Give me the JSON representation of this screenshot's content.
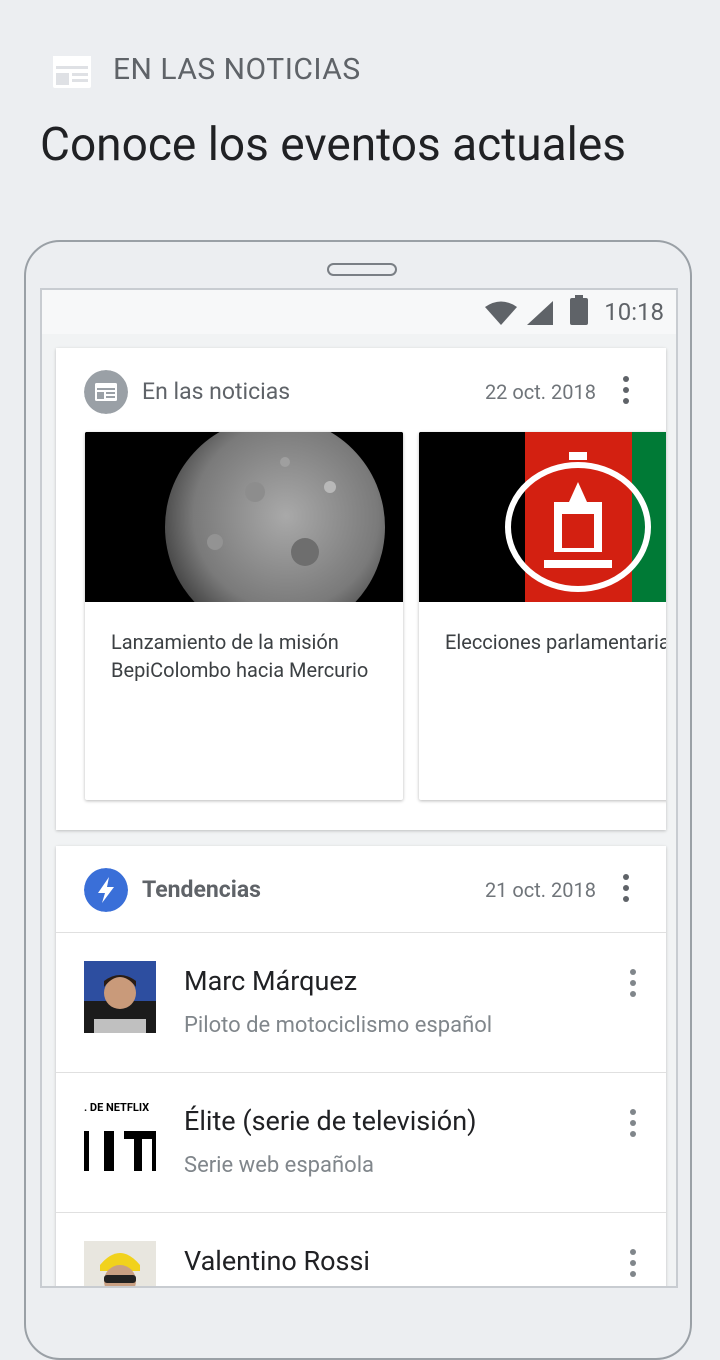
{
  "header": {
    "label": "EN LAS NOTICIAS",
    "title": "Conoce los eventos actuales"
  },
  "status_bar": {
    "time": "10:18"
  },
  "news_card": {
    "title": "En las noticias",
    "date": "22 oct. 2018",
    "items": [
      {
        "text": "Lanzamiento de la misión BepiColombo hacia Mercurio"
      },
      {
        "text": "Elecciones parlamentarias de Afganistán"
      }
    ]
  },
  "trends_card": {
    "title": "Tendencias",
    "date": "21 oct. 2018",
    "items": [
      {
        "name": "Marc Márquez",
        "desc": "Piloto de motociclismo español"
      },
      {
        "name": "Élite (serie de televisión)",
        "desc": "Serie web española",
        "thumb_caption": ". DE NETFLIX"
      },
      {
        "name": "Valentino Rossi",
        "desc": ""
      }
    ]
  },
  "colors": {
    "background": "#eceef1",
    "accent_blue": "#3a6fd8",
    "icon_gray": "#9aa0a6"
  },
  "icons": [
    "calendar-news-icon",
    "wifi-icon",
    "signal-icon",
    "battery-icon",
    "more-vert-icon",
    "lightning-icon"
  ]
}
